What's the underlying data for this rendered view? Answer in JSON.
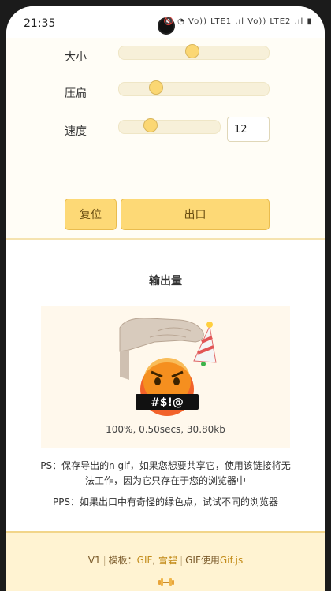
{
  "status_bar": {
    "time": "21:35",
    "icons_text": "🔇 ◔ Vo)) LTE1 .ıl Vo)) LTE2 .ıl ▮"
  },
  "controls": {
    "size_label": "大小",
    "size_value": 0.49,
    "squash_label": "压扁",
    "squash_value": 0.22,
    "speed_label": "速度",
    "speed_value": 0.28,
    "speed_input_value": "12"
  },
  "buttons": {
    "reset_label": "复位",
    "export_label": "出口"
  },
  "output": {
    "title": "输出量",
    "stats": "100%, 0.50secs, 30.80kb",
    "ps_note": "PS：保存导出的n gif，如果您想要共享它，使用该链接将无法工作，因为它只存在于您的浏览器中",
    "pps_note": "PPS：如果出口中有奇怪的绿色点，试试不同的浏览器",
    "emoji_text": "#$!@"
  },
  "footer": {
    "version": "V1",
    "template_prefix": "模板：",
    "template_gif": "GIF",
    "template_sep": ", ",
    "template_author": "雪碧",
    "gif_prefix": "GIF使用",
    "gif_lib": "Gif.js",
    "icon": "dumbbell-icon"
  },
  "colors": {
    "accent": "#fdd976",
    "accent_border": "#e9bc4e",
    "track": "#f7f0d9",
    "footer_bg": "#fff3d2",
    "link": "#c38c1a"
  }
}
